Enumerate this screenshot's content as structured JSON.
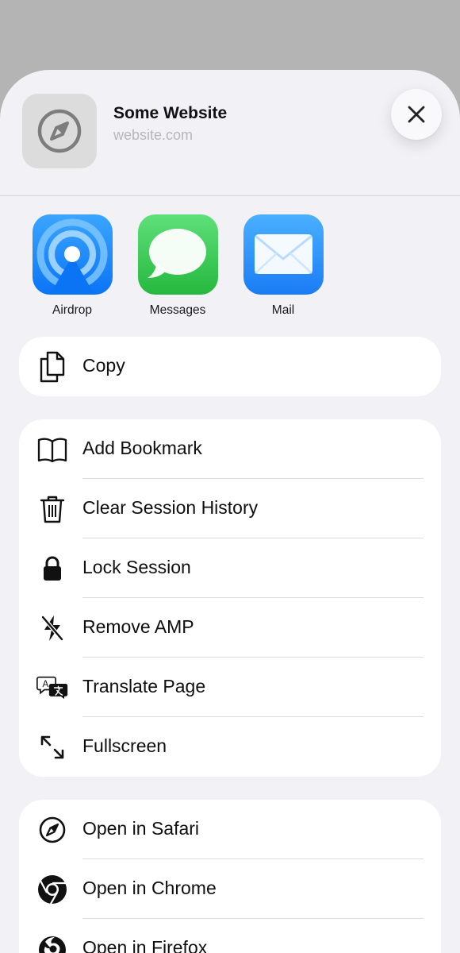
{
  "header": {
    "site_title": "Some Website",
    "site_url": "website.com",
    "thumb_icon": "compass-icon",
    "close_icon": "close-icon"
  },
  "apps": [
    {
      "label": "Airdrop",
      "icon": "airdrop-icon",
      "color": "#1a8cff"
    },
    {
      "label": "Messages",
      "icon": "messages-icon",
      "color": "#34c759"
    },
    {
      "label": "Mail",
      "icon": "mail-icon",
      "color": "#1a8cff"
    }
  ],
  "copy_action": {
    "label": "Copy",
    "icon": "copy-icon"
  },
  "actions": [
    {
      "label": "Add Bookmark",
      "icon": "book-icon"
    },
    {
      "label": "Clear Session History",
      "icon": "trash-icon"
    },
    {
      "label": "Lock Session",
      "icon": "lock-icon"
    },
    {
      "label": "Remove AMP",
      "icon": "bolt-slash-icon"
    },
    {
      "label": "Translate Page",
      "icon": "translate-icon"
    },
    {
      "label": "Fullscreen",
      "icon": "expand-icon"
    }
  ],
  "open_in": [
    {
      "label": "Open in Safari",
      "icon": "safari-icon"
    },
    {
      "label": "Open in Chrome",
      "icon": "chrome-icon"
    },
    {
      "label": "Open in Firefox",
      "icon": "firefox-icon"
    }
  ]
}
